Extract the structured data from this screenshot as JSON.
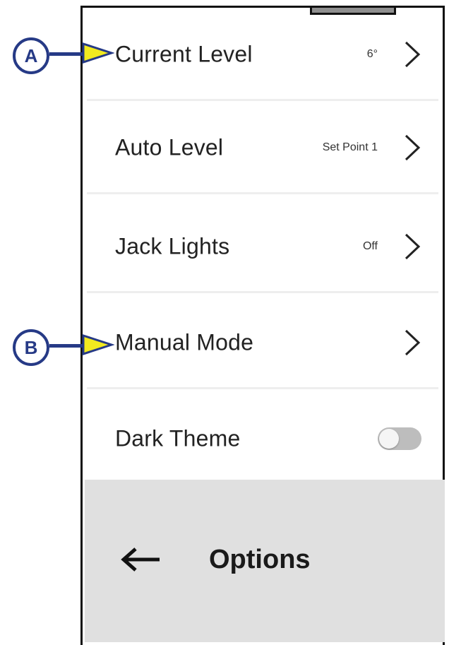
{
  "menu": {
    "items": [
      {
        "label": "Current Level",
        "value": "6°"
      },
      {
        "label": "Auto Level",
        "value": "Set Point 1"
      },
      {
        "label": "Jack Lights",
        "value": "Off"
      },
      {
        "label": "Manual Mode",
        "value": ""
      },
      {
        "label": "Dark Theme",
        "toggle": "off"
      }
    ]
  },
  "header": {
    "title": "Options",
    "back_icon": "arrow-left-icon"
  },
  "callouts": {
    "a": "A",
    "b": "B"
  },
  "colors": {
    "callout": "#263a86",
    "pointer": "#f2ea1f",
    "header_bg": "#e0e0e0",
    "toggle_off": "#bdbdbd"
  }
}
